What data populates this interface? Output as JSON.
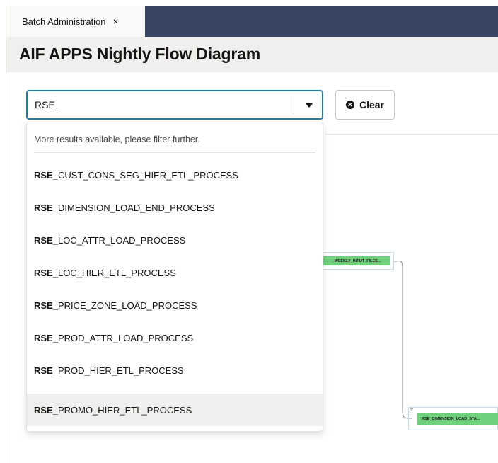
{
  "tab": {
    "label": "Batch Administration",
    "close": "×"
  },
  "page": {
    "title": "AIF APPS Nightly Flow Diagram"
  },
  "search": {
    "value": "RSE_"
  },
  "clear_button": {
    "label": "Clear",
    "icon": "close-circle-icon"
  },
  "dropdown": {
    "note": "More results available, please filter further.",
    "match_prefix": "RSE_",
    "items": [
      {
        "prefix": "RSE_",
        "rest": "CUST_CONS_SEG_HIER_ETL_PROCESS"
      },
      {
        "prefix": "RSE_",
        "rest": "DIMENSION_LOAD_END_PROCESS"
      },
      {
        "prefix": "RSE_",
        "rest": "LOC_ATTR_LOAD_PROCESS"
      },
      {
        "prefix": "RSE_",
        "rest": "LOC_HIER_ETL_PROCESS"
      },
      {
        "prefix": "RSE_",
        "rest": "PRICE_ZONE_LOAD_PROCESS"
      },
      {
        "prefix": "RSE_",
        "rest": "PROD_ATTR_LOAD_PROCESS"
      },
      {
        "prefix": "RSE_",
        "rest": "PROD_HIER_ETL_PROCESS"
      },
      {
        "prefix": "RSE_",
        "rest": "PROMO_HIER_ETL_PROCESS"
      }
    ],
    "highlighted_index": 7
  },
  "diagram": {
    "nodes": [
      {
        "label": "_WEEKLY_INPUT_FILES..."
      },
      {
        "label": "RSE_DIMENSION_LOAD_STA..."
      }
    ],
    "node_color": "#6fd07c"
  },
  "colors": {
    "tabbar": "#3a4563",
    "focus_border": "#227e9e",
    "header_band": "#f1efed"
  }
}
